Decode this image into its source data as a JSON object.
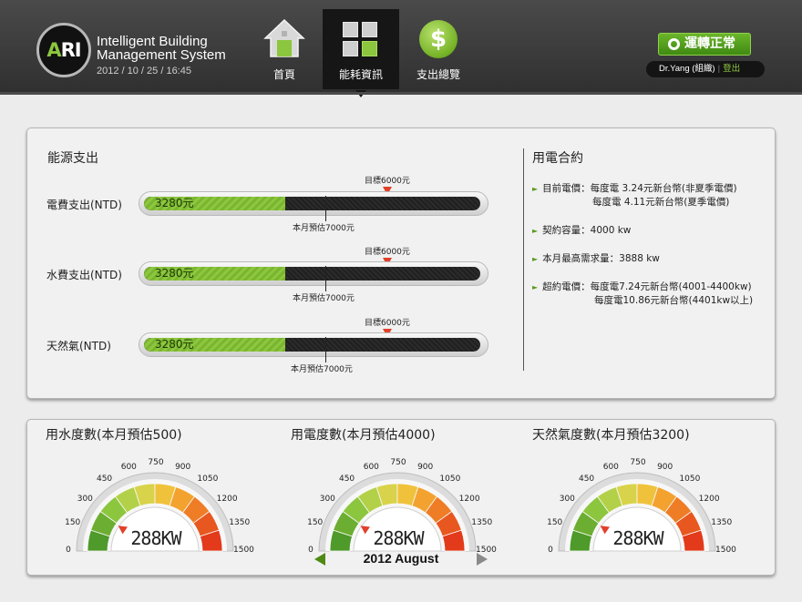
{
  "header": {
    "logo_text_a": "A",
    "logo_text_ri": "RI",
    "title_line1": "Intelligent Building",
    "title_line2": "Management System",
    "datetime": "2012 / 10 / 25 / 16:45",
    "nav": [
      {
        "label": "首頁",
        "icon": "home-icon",
        "active": false
      },
      {
        "label": "能耗資訊",
        "icon": "grid-icon",
        "active": true
      },
      {
        "label": "支出總覽",
        "icon": "dollar-icon",
        "active": false
      }
    ],
    "status_label": "運轉正常",
    "user": "Dr.Yang",
    "user_group": "(組織)",
    "logout_label": "登出"
  },
  "expenses": {
    "title": "能源支出",
    "bars": [
      {
        "label": "電費支出(NTD)",
        "value_label": "3280元",
        "fill_fraction": 0.42,
        "target_label": "目標6000元",
        "target_fraction": 0.72,
        "estimate_label": "本月預估7000元",
        "estimate_fraction": 0.52
      },
      {
        "label": "水費支出(NTD)",
        "value_label": "3280元",
        "fill_fraction": 0.42,
        "target_label": "目標6000元",
        "target_fraction": 0.72,
        "estimate_label": "本月預估7000元",
        "estimate_fraction": 0.52
      },
      {
        "label": "天然氣(NTD)",
        "value_label": "3280元",
        "fill_fraction": 0.42,
        "target_label": "目標6000元",
        "target_fraction": 0.72,
        "estimate_label": "本月預估7000元",
        "estimate_fraction": 0.52
      }
    ]
  },
  "contract": {
    "title": "用電合約",
    "current_price_label": "目前電價：每度電 3.24元新台幣(非夏季電價)",
    "current_price_line2": "每度電 4.11元新台幣(夏季電價)",
    "capacity": "契約容量：4000 kw",
    "max_demand": "本月最高需求量：3888 kw",
    "overage_label": "超約電價：每度電7.24元新台幣(4001-4400kw)",
    "overage_line2": "每度電10.86元新台幣(4401kw以上)"
  },
  "gauges": {
    "ticks": [
      "0",
      "150",
      "300",
      "450",
      "600",
      "750",
      "900",
      "1050",
      "1200",
      "1350",
      "1500"
    ],
    "items": [
      {
        "title": "用水度數(本月預估500)",
        "readout": "288KW",
        "value": 288
      },
      {
        "title": "用電度數(本月預估4000)",
        "readout": "288KW",
        "value": 288
      },
      {
        "title": "天然氣度數(本月預估3200)",
        "readout": "288KW",
        "value": 288
      }
    ],
    "month_label": "2012 August"
  },
  "colors": {
    "accent_green": "#8cc63f",
    "target_red": "#e2402b",
    "header_bg": "#3a3a3a"
  }
}
